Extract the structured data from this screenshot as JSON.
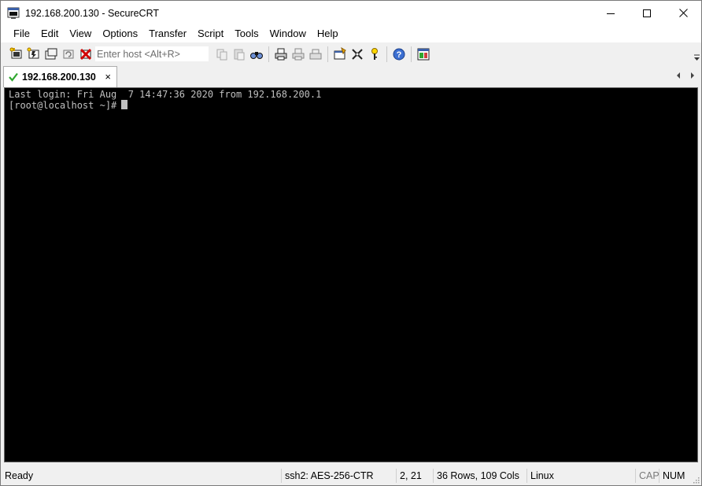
{
  "window": {
    "title": "192.168.200.130 - SecureCRT"
  },
  "menu": {
    "items": [
      "File",
      "Edit",
      "View",
      "Options",
      "Transfer",
      "Script",
      "Tools",
      "Window",
      "Help"
    ]
  },
  "toolbar": {
    "host_placeholder": "Enter host <Alt+R>",
    "icons_left": [
      "connect-icon",
      "quick-connect-icon",
      "connect-in-tab-icon",
      "reconnect-icon",
      "disconnect-icon"
    ],
    "icons_right": [
      "copy-icon",
      "paste-icon",
      "find-icon",
      "print-icon",
      "print-selection-icon",
      "print-setup-icon",
      "session-options-icon",
      "global-options-icon",
      "keymap-icon",
      "help-icon",
      "sftp-icon"
    ]
  },
  "tabs": [
    {
      "label": "192.168.200.130",
      "close": "×",
      "status_icon": "connected-check-icon"
    }
  ],
  "terminal": {
    "lines": [
      "Last login: Fri Aug  7 14:47:36 2020 from 192.168.200.1",
      "[root@localhost ~]#"
    ]
  },
  "status": {
    "state": "Ready",
    "cipher": "ssh2: AES-256-CTR",
    "position": "2,  21",
    "size": "36 Rows, 109 Cols",
    "terminal_type": "Linux",
    "caps": "CAP",
    "num": "NUM"
  },
  "colors": {
    "terminal_bg": "#000000",
    "terminal_fg": "#c0c0c0",
    "check": "#2fa72f"
  }
}
